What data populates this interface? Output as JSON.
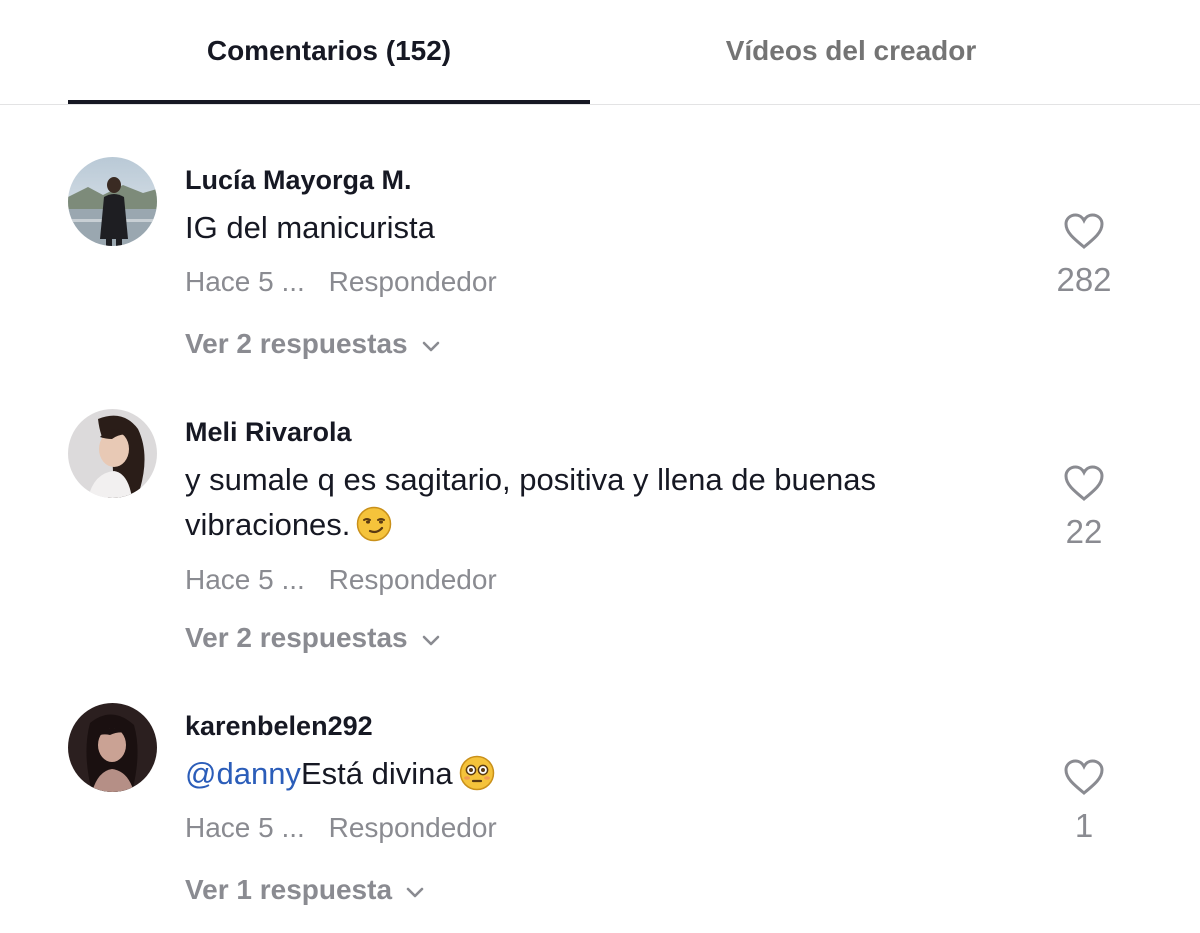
{
  "tabs": {
    "comments_label": "Comentarios (152)",
    "creator_label": "Vídeos del creador"
  },
  "comments": [
    {
      "username": "Lucía Mayorga M.",
      "mention": "",
      "text": "IG del manicurista",
      "emoji": "",
      "time": "Hace 5 ...",
      "reply_label": "Respondedor",
      "view_replies": "Ver 2 respuestas",
      "likes": "282",
      "avatar_icon": "avatar-photo"
    },
    {
      "username": "Meli Rivarola",
      "mention": "",
      "text": "y sumale q es sagitario, positiva y llena de buenas vibraciones.",
      "emoji": "smirk-face-emoji",
      "time": "Hace 5 ...",
      "reply_label": "Respondedor",
      "view_replies": "Ver 2 respuestas",
      "likes": "22",
      "avatar_icon": "avatar-photo"
    },
    {
      "username": "karenbelen292",
      "mention": "@danny",
      "text": "Está divina",
      "emoji": "flushed-face-emoji",
      "time": "Hace 5 ...",
      "reply_label": "Respondedor",
      "view_replies": "Ver 1 respuesta",
      "likes": "1",
      "avatar_icon": "avatar-photo"
    }
  ],
  "colors": {
    "text_primary": "#161823",
    "text_secondary": "#8a8b91",
    "mention": "#2b5db9",
    "divider": "#e3e3e4"
  }
}
